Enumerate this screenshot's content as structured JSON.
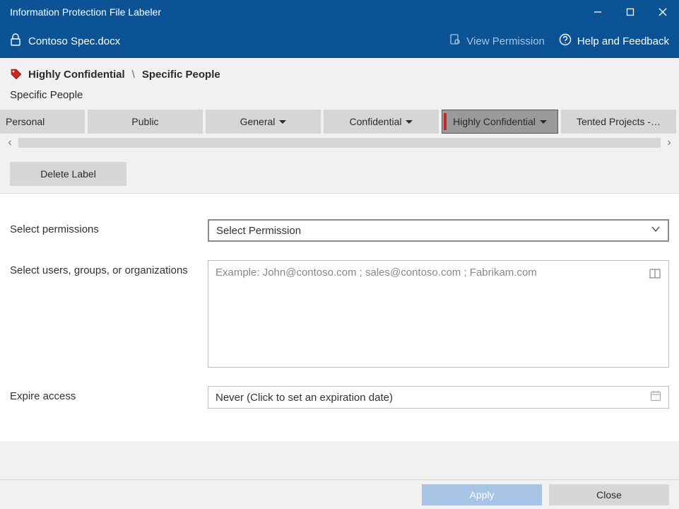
{
  "title_bar": {
    "title": "Information Protection File Labeler"
  },
  "toolbar": {
    "file_name": "Contoso Spec.docx",
    "view_permission": "View Permission",
    "help_feedback": "Help and Feedback"
  },
  "breadcrumb": {
    "level1": "Highly Confidential",
    "sep": "\\",
    "level2": "Specific People"
  },
  "subheading": "Specific People",
  "labels": [
    {
      "name": "Personal",
      "dropdown": false
    },
    {
      "name": "Public",
      "dropdown": false
    },
    {
      "name": "General",
      "dropdown": true
    },
    {
      "name": "Confidential",
      "dropdown": true
    },
    {
      "name": "Highly Confidential",
      "dropdown": true,
      "selected": true
    },
    {
      "name": "Tented Projects -…",
      "dropdown": false
    }
  ],
  "delete_label": "Delete Label",
  "form": {
    "permissions_label": "Select permissions",
    "permissions_placeholder": "Select Permission",
    "users_label": "Select users, groups, or organizations",
    "users_placeholder": "Example: John@contoso.com ; sales@contoso.com ; Fabrikam.com",
    "expire_label": "Expire access",
    "expire_placeholder": "Never (Click to set an expiration date)"
  },
  "footer": {
    "apply": "Apply",
    "close": "Close"
  }
}
